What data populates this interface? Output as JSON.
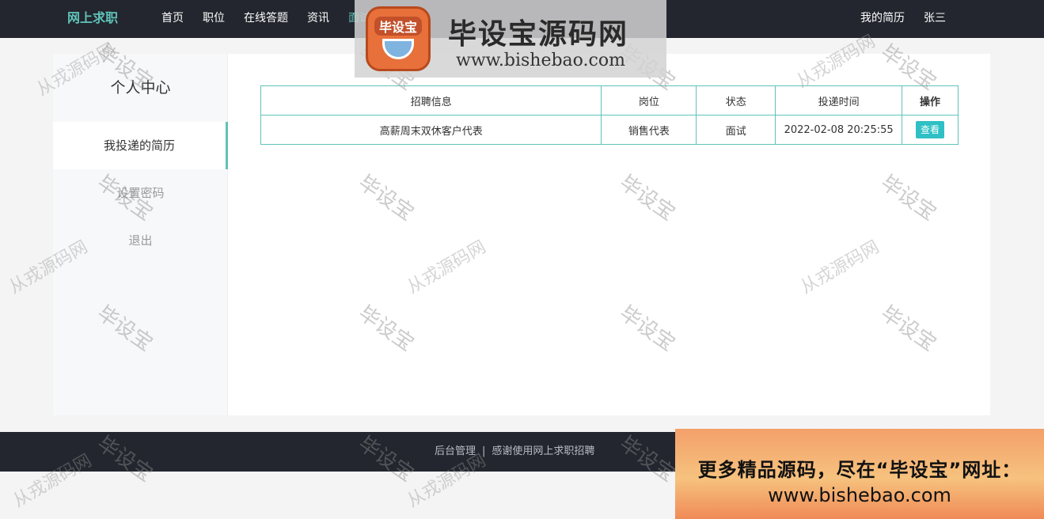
{
  "header": {
    "brand": "网上求职",
    "nav": [
      "首页",
      "职位",
      "在线答题",
      "资讯",
      "面试评价"
    ],
    "right": [
      "我的简历",
      "张三"
    ]
  },
  "sidebar": {
    "title": "个人中心",
    "items": [
      "我投递的简历",
      "设置密码",
      "退出"
    ]
  },
  "table": {
    "headers": [
      "招聘信息",
      "岗位",
      "状态",
      "投递时间",
      "操作"
    ],
    "rows": [
      {
        "info": "高薪周末双休客户代表",
        "position": "销售代表",
        "status": "面试",
        "time": "2022-02-08 20:25:55",
        "action": "查看"
      }
    ]
  },
  "footer": {
    "admin": "后台管理",
    "separator": "|",
    "thanks": "感谢使用网上求职招聘"
  },
  "watermark": {
    "main": "毕设宝",
    "secondary": "从戎源码网"
  },
  "logo": {
    "badge": "毕设宝",
    "title": "毕设宝源码网",
    "url": "www.bishebao.com"
  },
  "promo": {
    "line1": "更多精品源码，尽在“毕设宝”网址：",
    "line2": "www.bishebao.com"
  },
  "colors": {
    "accent": "#5fc3b9",
    "header_bg": "#23262e",
    "button": "#2ec0c4"
  }
}
